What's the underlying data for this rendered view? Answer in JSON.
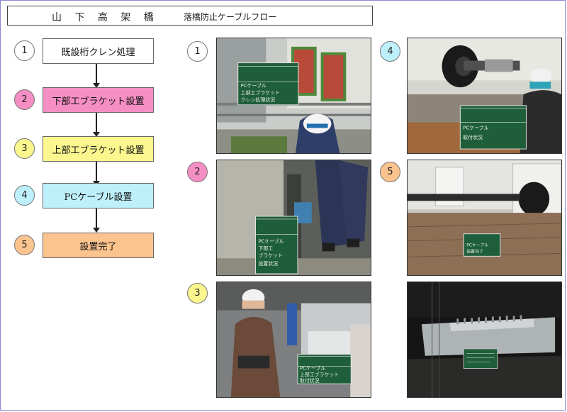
{
  "header": {
    "title": "山 下 高 架 橋",
    "subtitle": "落橋防止ケーブルフロー"
  },
  "flow": [
    {
      "num": "1",
      "label": "既設桁クレン処理",
      "fill": "#ffffff",
      "circle_fill": "#ffffff"
    },
    {
      "num": "2",
      "label": "下部工ブラケット設置",
      "fill": "#f58ec3",
      "circle_fill": "#f58ec3"
    },
    {
      "num": "3",
      "label": "上部工ブラケット設置",
      "fill": "#fbf78e",
      "circle_fill": "#fbf78e"
    },
    {
      "num": "4",
      "label": "PCケーブル設置",
      "fill": "#bdf0fb",
      "circle_fill": "#bdf0fb"
    },
    {
      "num": "5",
      "label": "設置完了",
      "fill": "#fbc48e",
      "circle_fill": "#fbc48e"
    }
  ],
  "photo_markers": [
    {
      "num": "1",
      "circle_fill": "#ffffff"
    },
    {
      "num": "2",
      "circle_fill": "#f58ec3"
    },
    {
      "num": "3",
      "circle_fill": "#fbf78e"
    },
    {
      "num": "4",
      "circle_fill": "#bdf0fb"
    },
    {
      "num": "5",
      "circle_fill": "#fbc48e"
    }
  ],
  "boards": {
    "p1": [
      "PCケーブル",
      "上部工ブラケット",
      "クレン処理状況"
    ],
    "p2": [
      "PCケーブル",
      "下部工",
      "ブラケット",
      "設置状況"
    ],
    "p3": [
      "PCケーブル",
      "上部工ブラケット",
      "取付状況"
    ],
    "p4": [
      "PCケーブル",
      "取付状況"
    ],
    "p5": [
      "PCケーブル",
      "設置完了"
    ]
  },
  "colors": {
    "board_green": "#1f5e3a",
    "frame": "#8a8ad0"
  }
}
